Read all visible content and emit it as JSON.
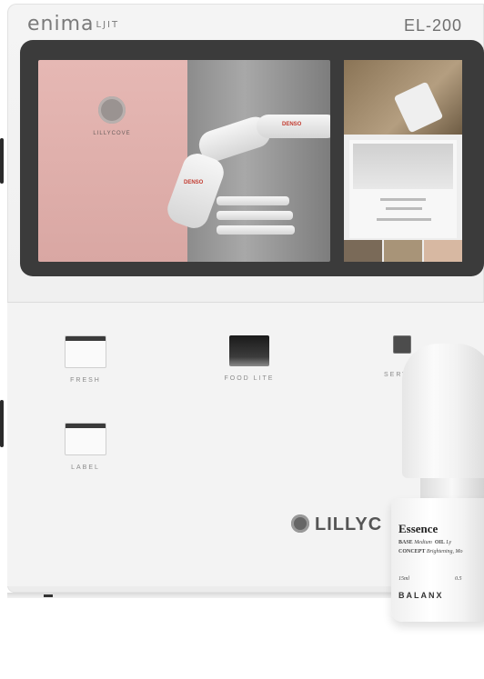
{
  "device": {
    "brand": "enima",
    "brand_sub": "LJIT",
    "model": "EL-200",
    "screen": {
      "main_brand_text": "LILLYCOVE",
      "tag_text": "DENSO"
    },
    "panel": {
      "tiles": [
        {
          "label": "FRESH"
        },
        {
          "label": "FOOD LITE"
        },
        {
          "label": "SERVICE"
        },
        {
          "label": "LABEL"
        }
      ],
      "logo_text": "LILLYC"
    }
  },
  "product": {
    "title": "Essence",
    "base_label": "BASE",
    "base_value": "Medium",
    "oil_label": "OIL",
    "oil_value": "Ly",
    "concept_label": "CONCEPT",
    "concept_value": "Brightening, Mo",
    "volume": "15ml",
    "code": "0.5",
    "brand": "BALANX"
  }
}
